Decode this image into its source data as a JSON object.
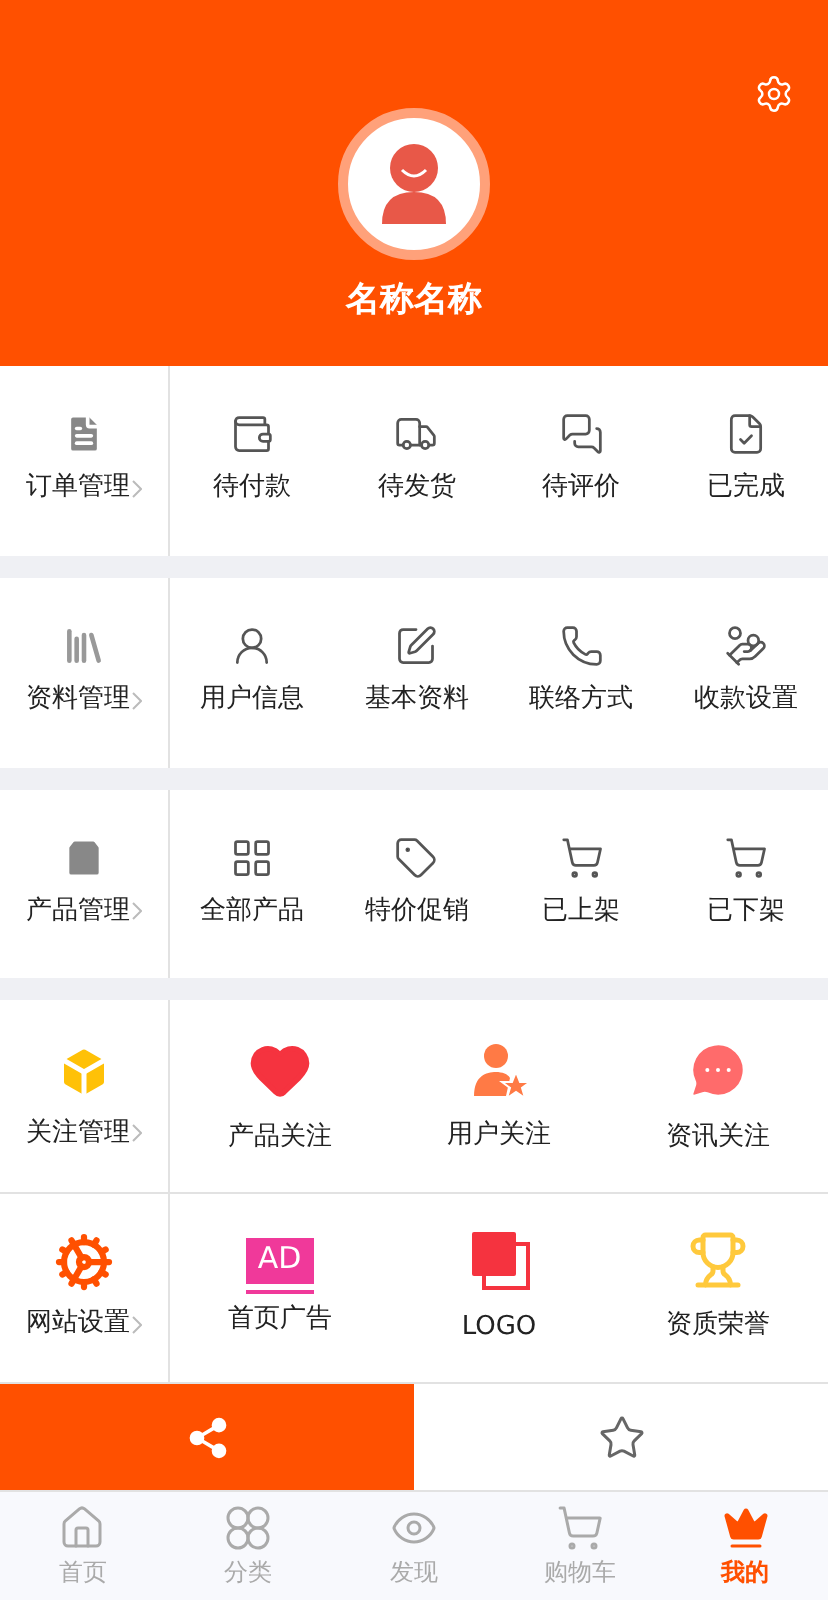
{
  "profile": {
    "name": "名称名称"
  },
  "sections": [
    {
      "title": "订单管理",
      "items": [
        {
          "label": "待付款"
        },
        {
          "label": "待发货"
        },
        {
          "label": "待评价"
        },
        {
          "label": "已完成"
        }
      ]
    },
    {
      "title": "资料管理",
      "items": [
        {
          "label": "用户信息"
        },
        {
          "label": "基本资料"
        },
        {
          "label": "联络方式"
        },
        {
          "label": "收款设置"
        }
      ]
    },
    {
      "title": "产品管理",
      "items": [
        {
          "label": "全部产品"
        },
        {
          "label": "特价促销"
        },
        {
          "label": "已上架"
        },
        {
          "label": "已下架"
        }
      ]
    },
    {
      "title": "关注管理",
      "items": [
        {
          "label": "产品关注"
        },
        {
          "label": "用户关注"
        },
        {
          "label": "资讯关注"
        }
      ]
    },
    {
      "title": "网站设置",
      "items": [
        {
          "label": "首页广告",
          "badge": "AD"
        },
        {
          "label": "LOGO"
        },
        {
          "label": "资质荣誉"
        }
      ]
    }
  ],
  "actions": [
    {
      "kind": "share",
      "selected": true
    },
    {
      "kind": "favorite",
      "selected": false
    }
  ],
  "tabs": [
    {
      "label": "首页",
      "selected": false
    },
    {
      "label": "分类",
      "selected": false
    },
    {
      "label": "发现",
      "selected": false
    },
    {
      "label": "购物车",
      "selected": false
    },
    {
      "label": "我的",
      "selected": true
    }
  ]
}
